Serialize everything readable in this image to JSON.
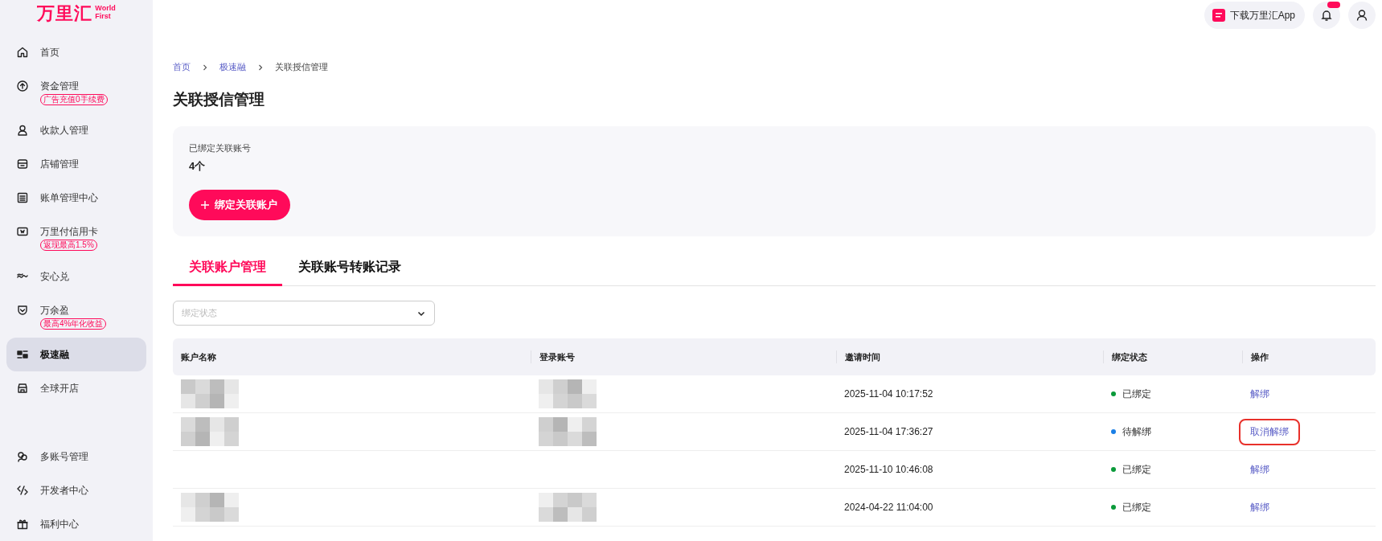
{
  "logo": {
    "name": "万里汇",
    "sub_1": "World",
    "sub_2": "First"
  },
  "sidebar": {
    "items": [
      {
        "label": "首页",
        "selected": false
      },
      {
        "label": "资金管理",
        "tag": "广告充值0手续费",
        "selected": false
      },
      {
        "label": "收款人管理",
        "selected": false
      },
      {
        "label": "店铺管理",
        "selected": false
      },
      {
        "label": "账单管理中心",
        "selected": false
      },
      {
        "label": "万里付信用卡",
        "tag": "返现最高1.5%",
        "selected": false
      },
      {
        "label": "安心兑",
        "selected": false
      },
      {
        "label": "万余盈",
        "tag": "最高4%年化收益",
        "selected": false
      },
      {
        "label": "极速融",
        "selected": true
      },
      {
        "label": "全球开店",
        "selected": false
      }
    ],
    "bottom_items": [
      {
        "label": "多账号管理",
        "selected": false
      },
      {
        "label": "开发者中心",
        "selected": false
      },
      {
        "label": "福利中心",
        "selected": false
      }
    ]
  },
  "topbar": {
    "download_button": "下载万里汇App",
    "notification_badge": true
  },
  "breadcrumb": [
    {
      "label": "首页",
      "link": true
    },
    {
      "label": "极速融",
      "link": true
    },
    {
      "label": "关联授信管理",
      "link": false
    }
  ],
  "page_title": "关联授信管理",
  "summary": {
    "label": "已绑定关联账号",
    "value": "4个",
    "button": "绑定关联账户"
  },
  "tabs": [
    {
      "label": "关联账户管理",
      "selected": true
    },
    {
      "label": "关联账号转账记录",
      "selected": false
    }
  ],
  "filter": {
    "placeholder": "绑定状态"
  },
  "table": {
    "columns": [
      "账户名称",
      "登录账号",
      "邀请时间",
      "绑定状态",
      "操作"
    ],
    "rows": [
      {
        "account_name": {
          "kind": "mosaic"
        },
        "login": {
          "kind": "mosaic"
        },
        "time": "2025-11-04 10:17:52",
        "status": {
          "label": "已绑定",
          "color": "#0a9a3a"
        },
        "action": {
          "label": "解绑",
          "highlighted": false
        }
      },
      {
        "account_name": {
          "kind": "mosaic"
        },
        "login": {
          "kind": "mosaic"
        },
        "time": "2025-11-04 17:36:27",
        "status": {
          "label": "待解绑",
          "color": "#1a7fe6"
        },
        "action": {
          "label": "取消解绑",
          "highlighted": true
        }
      },
      {
        "time": "2025-11-10 10:46:08",
        "status": {
          "label": "已绑定",
          "color": "#0a9a3a"
        },
        "action": {
          "label": "解绑",
          "highlighted": false
        }
      },
      {
        "account_name": {
          "kind": "mosaic"
        },
        "login": {
          "kind": "mosaic"
        },
        "time": "2024-04-22 11:04:00",
        "status": {
          "label": "已绑定",
          "color": "#0a9a3a"
        },
        "action": {
          "label": "解绑",
          "highlighted": false
        }
      }
    ]
  }
}
